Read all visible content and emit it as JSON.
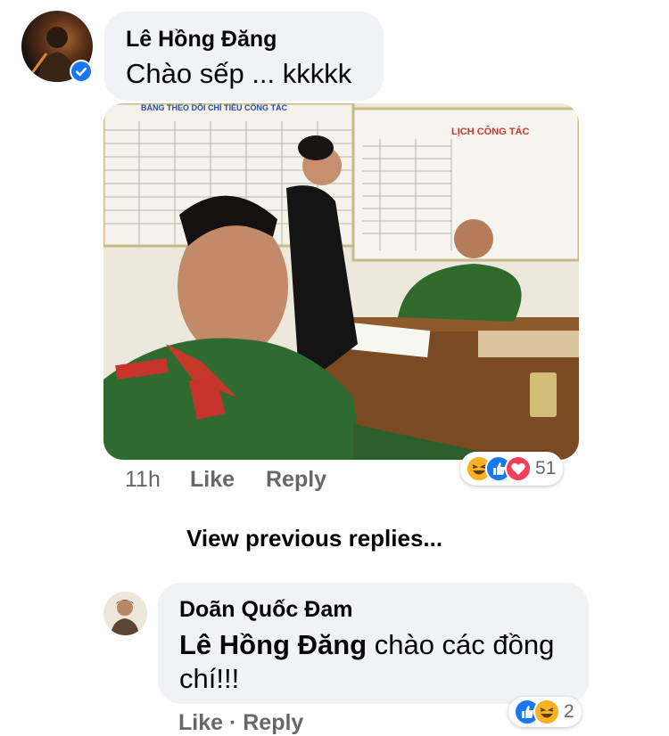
{
  "comment": {
    "author": "Lê Hồng Đăng",
    "text": "Chào sếp ... kkkkk",
    "time": "11h",
    "like_label": "Like",
    "reply_label": "Reply",
    "reaction_count": "51",
    "reactions": [
      "haha-icon",
      "like-icon",
      "love-icon"
    ],
    "verified": true
  },
  "photo": {
    "board_title_left": "BẢNG THEO DÕI CHỈ TIÊU CÔNG TÁC",
    "board_title_right": "LỊCH CÔNG TÁC"
  },
  "view_previous_label": "View previous replies...",
  "reply": {
    "author": "Doãn Quốc Đam",
    "mention": "Lê Hồng Đăng",
    "text_line1": " chào các đồng",
    "text_line2": "chí!!!",
    "reaction_count": "2",
    "partial_actions": "Like · Reply"
  },
  "colors": {
    "bubble": "#f0f2f5",
    "meta_text": "#65676b",
    "verified_blue": "#1877f2",
    "like_blue": "#1877f2",
    "love_red": "#f33e58",
    "haha_yellow": "#f7b125"
  }
}
